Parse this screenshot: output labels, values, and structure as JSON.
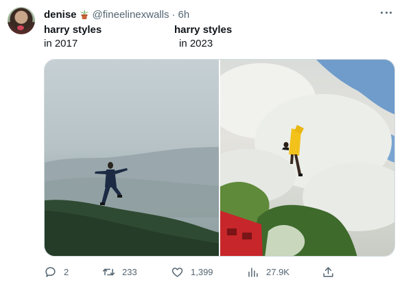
{
  "tweet": {
    "author_name": "denise",
    "author_handle": "@fineelinexwalls",
    "separator": "·",
    "time": "6h",
    "captions": {
      "left_title": "harry styles",
      "left_sub": "in 2017",
      "right_title": "harry styles",
      "right_sub": "in 2023"
    }
  },
  "actions": {
    "replies": "2",
    "retweets": "233",
    "likes": "1,399",
    "views": "27.9K"
  },
  "icons": {
    "author_badge": "potted-plant-icon",
    "more": "more-icon",
    "reply": "reply-icon",
    "retweet": "retweet-icon",
    "like": "heart-icon",
    "views": "views-chart-icon",
    "share": "share-icon"
  },
  "colors": {
    "text_primary": "#0f1419",
    "text_secondary": "#536471",
    "border": "#cfd9de"
  }
}
